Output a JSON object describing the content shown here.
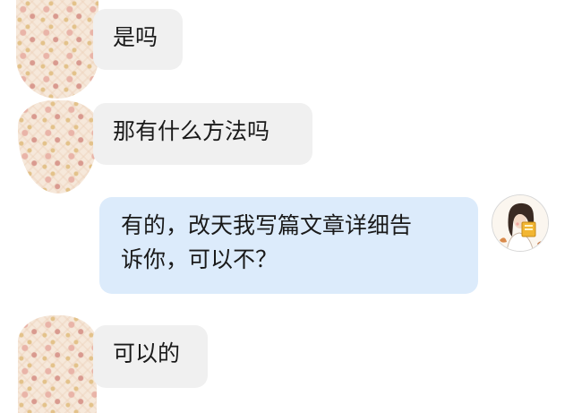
{
  "messages": [
    {
      "side": "left",
      "text": "是吗"
    },
    {
      "side": "left",
      "text": "那有什么方法吗"
    },
    {
      "side": "right",
      "lines": [
        "有的，改天我写篇文章详细告",
        "诉你，可以不？"
      ]
    },
    {
      "side": "left",
      "text": "可以的"
    }
  ],
  "avatars": {
    "contact_icon": "cat-pattern-avatar-icon",
    "self_icon": "girl-reading-avatar-icon"
  },
  "colors": {
    "incoming_bubble": "#f0f0f0",
    "outgoing_bubble": "#dcebfb",
    "text": "#1a1a1a",
    "pattern_base": "#f6e8da"
  }
}
